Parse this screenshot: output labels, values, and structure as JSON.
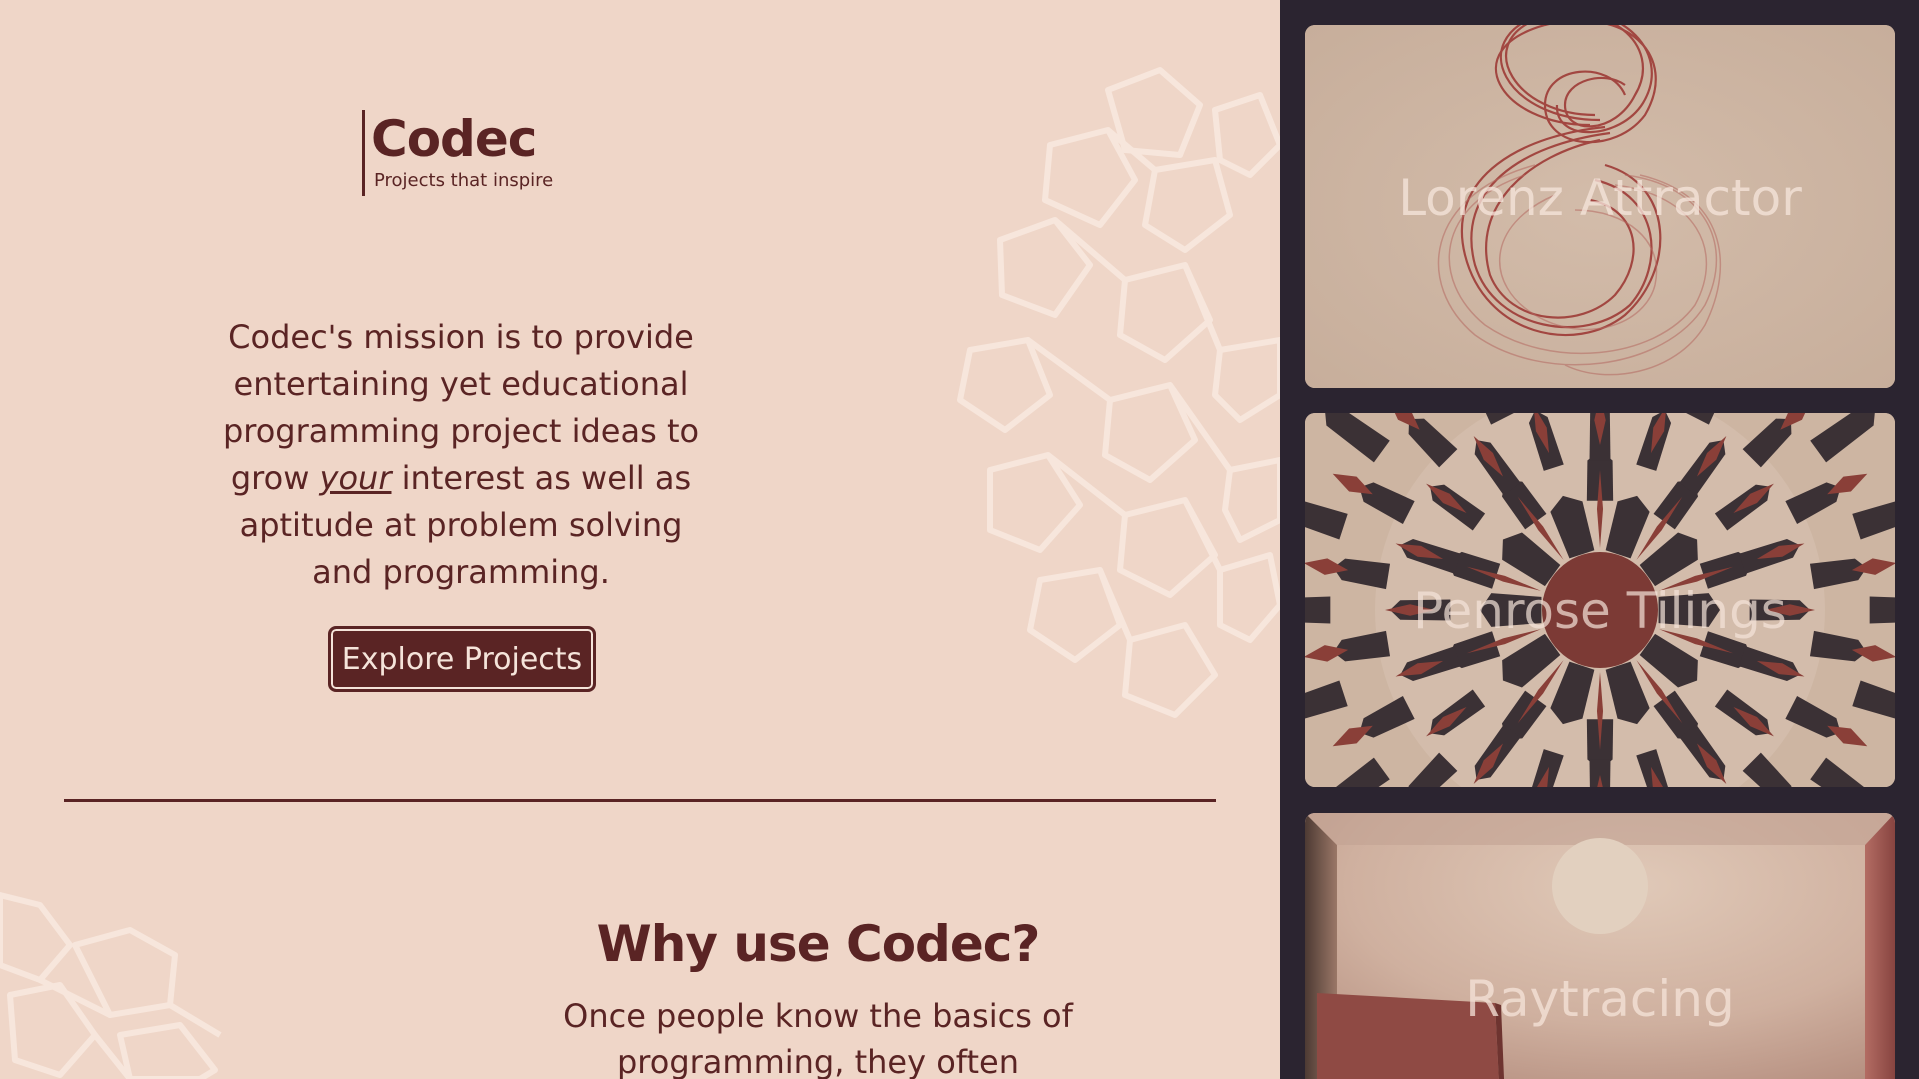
{
  "brand": {
    "name": "Codec",
    "tagline": "Projects that inspire"
  },
  "hero": {
    "mission_before": "Codec's mission is to provide entertaining yet educational programming project ideas to grow ",
    "mission_emphasis": "your",
    "mission_after": " interest as well as aptitude at problem solving and programming.",
    "cta_label": "Explore Projects"
  },
  "why": {
    "title": "Why use Codec?",
    "body": "Once people know the basics of programming, they often"
  },
  "projects": [
    {
      "title": "Lorenz Attractor"
    },
    {
      "title": "Penrose Tilings"
    },
    {
      "title": "Raytracing"
    }
  ],
  "colors": {
    "background": "#efd6c8",
    "primary": "#5a2424",
    "sidebar": "#2b2430",
    "accent": "#7c3a35"
  }
}
